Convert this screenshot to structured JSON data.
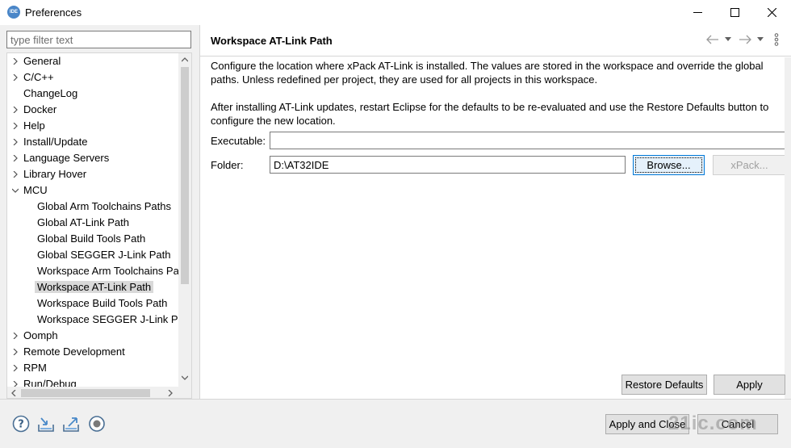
{
  "window": {
    "title": "Preferences",
    "app_icon_label": "IDE",
    "icons": {
      "minimize": "minimize-icon",
      "maximize": "maximize-icon",
      "close": "close-icon"
    }
  },
  "filter": {
    "placeholder": "type filter text",
    "value": ""
  },
  "tree": {
    "items": [
      {
        "label": "General",
        "depth": 0,
        "expandable": true,
        "expanded": false
      },
      {
        "label": "C/C++",
        "depth": 0,
        "expandable": true,
        "expanded": false
      },
      {
        "label": "ChangeLog",
        "depth": 0,
        "expandable": false
      },
      {
        "label": "Docker",
        "depth": 0,
        "expandable": true,
        "expanded": false
      },
      {
        "label": "Help",
        "depth": 0,
        "expandable": true,
        "expanded": false
      },
      {
        "label": "Install/Update",
        "depth": 0,
        "expandable": true,
        "expanded": false
      },
      {
        "label": "Language Servers",
        "depth": 0,
        "expandable": true,
        "expanded": false
      },
      {
        "label": "Library Hover",
        "depth": 0,
        "expandable": true,
        "expanded": false
      },
      {
        "label": "MCU",
        "depth": 0,
        "expandable": true,
        "expanded": true
      },
      {
        "label": "Global Arm Toolchains Paths",
        "depth": 1,
        "expandable": false
      },
      {
        "label": "Global AT-Link Path",
        "depth": 1,
        "expandable": false
      },
      {
        "label": "Global Build Tools Path",
        "depth": 1,
        "expandable": false
      },
      {
        "label": "Global SEGGER J-Link Path",
        "depth": 1,
        "expandable": false
      },
      {
        "label": "Workspace Arm Toolchains Pa",
        "depth": 1,
        "expandable": false
      },
      {
        "label": "Workspace AT-Link Path",
        "depth": 1,
        "expandable": false,
        "selected": true
      },
      {
        "label": "Workspace Build Tools Path",
        "depth": 1,
        "expandable": false
      },
      {
        "label": "Workspace SEGGER J-Link Pat",
        "depth": 1,
        "expandable": false
      },
      {
        "label": "Oomph",
        "depth": 0,
        "expandable": true,
        "expanded": false
      },
      {
        "label": "Remote Development",
        "depth": 0,
        "expandable": true,
        "expanded": false
      },
      {
        "label": "RPM",
        "depth": 0,
        "expandable": true,
        "expanded": false
      },
      {
        "label": "Run/Debug",
        "depth": 0,
        "expandable": true,
        "expanded": false
      }
    ]
  },
  "page": {
    "title": "Workspace AT-Link Path",
    "nav_icons": [
      "back-arrow-icon",
      "chevron-down-icon",
      "forward-arrow-icon",
      "chevron-down-icon",
      "vertical-dots-menu-icon"
    ],
    "description_1": "Configure the location where xPack AT-Link is installed. The values are stored in the workspace and override the global paths. Unless redefined per project, they are used for all projects in this workspace.",
    "description_2": "After installing AT-Link updates, restart Eclipse for the defaults to be re-evaluated and use the Restore Defaults button to configure the new location.",
    "executable_label": "Executable:",
    "executable_value": "",
    "folder_label": "Folder:",
    "folder_value": "D:\\AT32IDE",
    "browse_label": "Browse...",
    "xpack_label": "xPack...",
    "restore_defaults_label": "Restore Defaults",
    "apply_label": "Apply"
  },
  "bottom": {
    "icons": [
      "help-icon",
      "import-icon",
      "export-icon",
      "record-icon"
    ],
    "apply_close_label": "Apply and Close",
    "cancel_label": "Cancel"
  },
  "watermark": "21ic.com"
}
